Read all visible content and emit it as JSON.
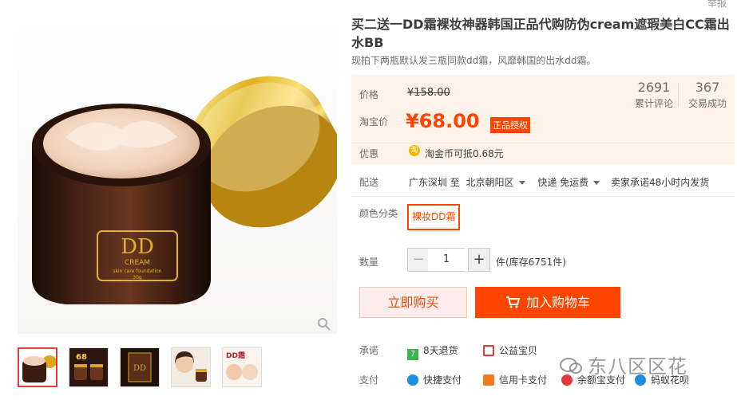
{
  "header": {
    "report_link": "举报"
  },
  "product": {
    "title": "买二送一DD霜裸妆神器韩国正品代购防伪cream遮瑕美白CC霜出水BB",
    "subtitle": "现拍下两瓶默认发三瓶同款dd霜，风靡韩国的出水dd霜。"
  },
  "gallery": {
    "jar_label": "DD",
    "jar_sublabel": "CREAM",
    "jar_small": "skin care foundation",
    "jar_weight": "30g",
    "thumbnails": [
      {
        "name": "thumb-1"
      },
      {
        "name": "thumb-2"
      },
      {
        "name": "thumb-3"
      },
      {
        "name": "thumb-4"
      },
      {
        "name": "thumb-5"
      }
    ],
    "thumb2_text": "68",
    "thumb4_text": "DD霜"
  },
  "price": {
    "original_label": "价格",
    "original_value": "¥158.00",
    "taobao_label": "淘宝价",
    "taobao_value": "¥68.00",
    "badge": "正品授权"
  },
  "stats": {
    "reviews_count": "2691",
    "reviews_label": "累计评论",
    "sales_count": "367",
    "sales_label": "交易成功"
  },
  "promo": {
    "label": "优惠",
    "coin_icon_text": "淘",
    "text": "淘金币可抵0.68元"
  },
  "shipping": {
    "label": "配送",
    "from": "广东深圳 至",
    "to": "北京朝阳区",
    "method": "快递 免运费",
    "promise": "卖家承诺48小时内发货"
  },
  "sku": {
    "label": "颜色分类",
    "option": "裸妆DD霜"
  },
  "quantity": {
    "label": "数量",
    "minus": "−",
    "value": "1",
    "plus": "+",
    "stock": "件(库存6751件)"
  },
  "buttons": {
    "buy_now": "立即购买",
    "add_cart": "加入购物车"
  },
  "guarantee": {
    "label": "承诺",
    "items": [
      {
        "icon": "seven-day-return-icon",
        "text": "8天退货",
        "color": "#39b54a"
      },
      {
        "icon": "charity-icon",
        "text": "公益宝贝",
        "color": "#e4393c"
      }
    ]
  },
  "payment": {
    "label": "支付",
    "items": [
      {
        "icon": "quick-pay-icon",
        "text": "快捷支付",
        "color": "#1a8ee1"
      },
      {
        "icon": "credit-card-icon",
        "text": "信用卡支付",
        "color": "#f47a20"
      },
      {
        "icon": "yuebao-icon",
        "text": "余额宝支付",
        "color": "#e4393c"
      },
      {
        "icon": "huabei-icon",
        "text": "蚂蚁花呗",
        "color": "#1a8ee1"
      }
    ]
  },
  "watermark": {
    "text": "东八区区花"
  },
  "colors": {
    "accent": "#ff4400",
    "price_bg": "#fff2e8",
    "buy_bg": "#ffeded"
  }
}
